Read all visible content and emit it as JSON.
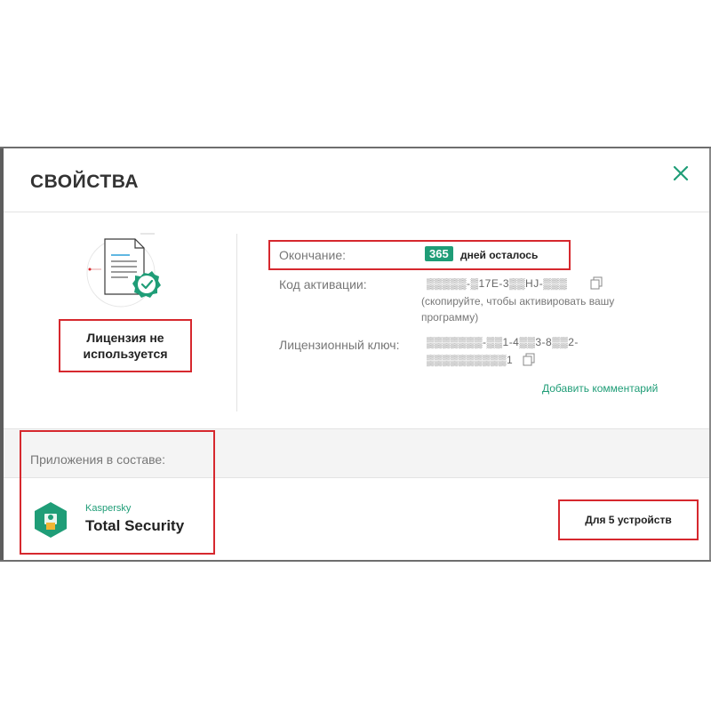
{
  "dialog": {
    "title": "СВОЙСТВА",
    "close_icon": "close-icon"
  },
  "license": {
    "illustration_icon": "certificate-check-icon",
    "status_text": "Лицензия не используется",
    "expiry_label": "Окончание:",
    "days_left": "365",
    "days_left_text": "дней осталось",
    "activation_code_label": "Код активации:",
    "activation_code_value": "▒▒▒▒▒-▒17E-3▒▒HJ-▒▒▒",
    "activation_hint": "(скопируйте, чтобы активировать вашу программу)",
    "license_key_label": "Лицензионный ключ:",
    "license_key_line1": "▒▒▒▒▒▒▒-▒▒1-4▒▒3-8▒▒2-",
    "license_key_line2": "▒▒▒▒▒▒▒▒▒▒1",
    "add_comment": "Добавить комментарий"
  },
  "apps": {
    "label": "Приложения в составе:",
    "product_brand": "Kaspersky",
    "product_name": "Total Security",
    "devices": "Для 5 устройств"
  },
  "colors": {
    "accent": "#1f9d77",
    "highlight_border": "#d6282e"
  }
}
